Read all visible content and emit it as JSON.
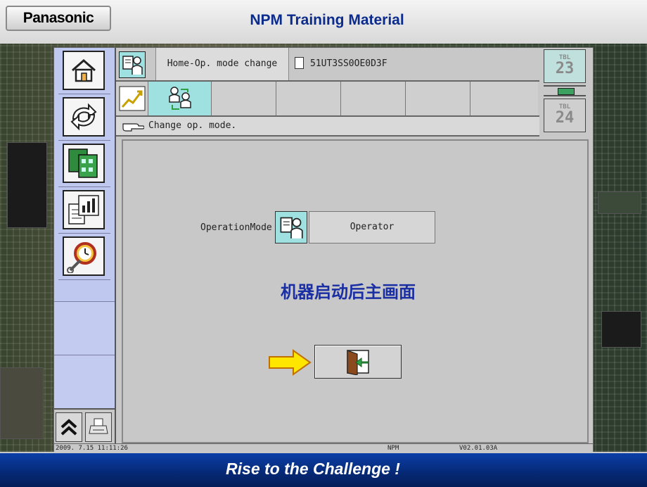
{
  "slide": {
    "brand": "Panasonic",
    "title": "NPM Training Material",
    "tagline": "Rise to the Challenge !"
  },
  "ui": {
    "header": {
      "title": "Home-Op. mode change",
      "file": "51UT3SS0OE0D3F"
    },
    "message": "Change op. mode.",
    "tables": [
      {
        "label": "TBL",
        "number": "23"
      },
      {
        "label": "TBL",
        "number": "24"
      }
    ],
    "operation_mode": {
      "label": "OperationMode",
      "value": "Operator"
    },
    "main_heading": "机器启动后主画面",
    "status_bar": {
      "datetime": "2009. 7.15 11:11:26",
      "machine": "NPM",
      "version": "V02.01.03A"
    },
    "sidebar_icons": [
      "home-icon",
      "changeover-icon",
      "pcb-data-icon",
      "report-icon",
      "maintenance-alarm-icon"
    ],
    "colors": {
      "sidebar": "#bfc8ee",
      "icon_highlight": "#9fe0e0",
      "heading": "#1b2fa4",
      "arrow": "#ffe600",
      "exit_green": "#2ea043"
    }
  }
}
